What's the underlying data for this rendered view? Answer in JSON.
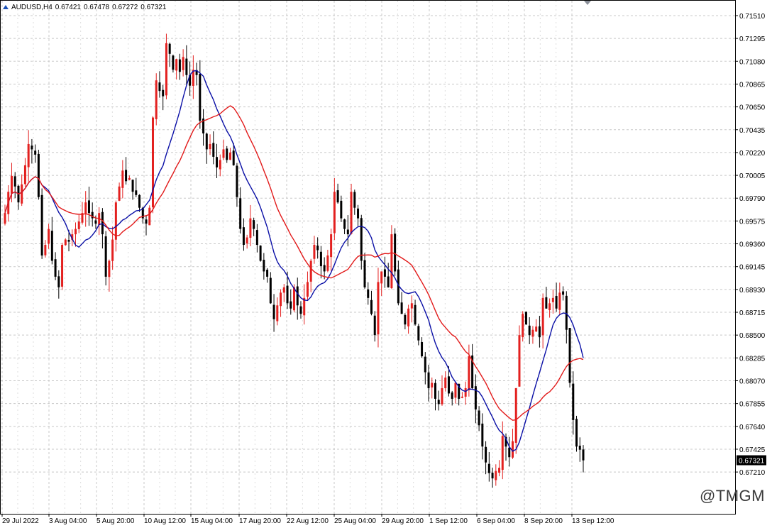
{
  "header": {
    "symbol_timeframe": "AUDUSD,H4",
    "open": "0.67421",
    "high": "0.67478",
    "low": "0.67272",
    "close": "0.67321"
  },
  "watermark": "@TMGM",
  "colors": {
    "bull": "#e3201f",
    "bear": "#000000",
    "green_wick": "#26a02a",
    "ma_fast": "#0a0fa6",
    "ma_slow": "#e21a1a",
    "grid": "#c8c8c8",
    "price_tag_bg": "#000000",
    "price_tag_fg": "#ffffff"
  },
  "chart_data": {
    "type": "candlestick",
    "symbol": "AUDUSD",
    "timeframe": "H4",
    "y_ticks": [
      "0.71510",
      "0.71295",
      "0.71080",
      "0.70865",
      "0.70650",
      "0.70435",
      "0.70220",
      "0.70005",
      "0.69790",
      "0.69575",
      "0.69360",
      "0.69145",
      "0.68930",
      "0.68715",
      "0.68500",
      "0.68285",
      "0.68070",
      "0.67855",
      "0.67640",
      "0.67425",
      "0.67210"
    ],
    "ylim": [
      0.6693,
      0.7155
    ],
    "x_ticks": [
      "29 Jul 2022",
      "3 Aug 04:00",
      "5 Aug 20:00",
      "10 Aug 12:00",
      "15 Aug 04:00",
      "17 Aug 20:00",
      "22 Aug 12:00",
      "25 Aug 04:00",
      "29 Aug 20:00",
      "1 Sep 12:00",
      "6 Sep 04:00",
      "8 Sep 20:00",
      "13 Sep 12:00"
    ],
    "current_price": "0.67321",
    "closes": [
      0.6965,
      0.6985,
      0.7,
      0.699,
      0.6975,
      0.6992,
      0.701,
      0.703,
      0.7025,
      0.702,
      0.698,
      0.6925,
      0.6935,
      0.695,
      0.692,
      0.6905,
      0.6895,
      0.6935,
      0.694,
      0.6938,
      0.6945,
      0.695,
      0.6957,
      0.6965,
      0.6975,
      0.6965,
      0.696,
      0.6955,
      0.6965,
      0.6945,
      0.6905,
      0.692,
      0.694,
      0.6975,
      0.699,
      0.7005,
      0.6995,
      0.6998,
      0.6985,
      0.6982,
      0.697,
      0.696,
      0.6955,
      0.697,
      0.7055,
      0.709,
      0.708,
      0.7075,
      0.7125,
      0.7115,
      0.71,
      0.711,
      0.7098,
      0.7112,
      0.7095,
      0.7085,
      0.71,
      0.7095,
      0.7052,
      0.704,
      0.7025,
      0.703,
      0.7018,
      0.7008,
      0.7015,
      0.7025,
      0.7015,
      0.7022,
      0.701,
      0.698,
      0.695,
      0.6935,
      0.6942,
      0.696,
      0.695,
      0.6935,
      0.692,
      0.691,
      0.6905,
      0.688,
      0.6865,
      0.6878,
      0.689,
      0.6895,
      0.688,
      0.6875,
      0.6895,
      0.6878,
      0.687,
      0.6885,
      0.69,
      0.692,
      0.6935,
      0.693,
      0.6915,
      0.691,
      0.6925,
      0.6945,
      0.6985,
      0.6975,
      0.696,
      0.695,
      0.6945,
      0.6985,
      0.697,
      0.696,
      0.692,
      0.6895,
      0.6885,
      0.687,
      0.685,
      0.69,
      0.691,
      0.6905,
      0.6895,
      0.6945,
      0.691,
      0.688,
      0.687,
      0.686,
      0.6875,
      0.688,
      0.686,
      0.6845,
      0.683,
      0.6815,
      0.68,
      0.6805,
      0.679,
      0.6785,
      0.68,
      0.681,
      0.6795,
      0.679,
      0.6805,
      0.679,
      0.6792,
      0.68,
      0.683,
      0.68,
      0.678,
      0.6765,
      0.6745,
      0.673,
      0.672,
      0.6715,
      0.6722,
      0.6725,
      0.6755,
      0.6745,
      0.6735,
      0.675,
      0.68,
      0.685,
      0.687,
      0.686,
      0.685,
      0.6855,
      0.6858,
      0.6848,
      0.6885,
      0.6875,
      0.688,
      0.6885,
      0.6875,
      0.689,
      0.6888,
      0.6855,
      0.6805,
      0.677,
      0.6745,
      0.6742,
      0.6732
    ],
    "ma_fast_name": "",
    "ma_slow_name": ""
  }
}
